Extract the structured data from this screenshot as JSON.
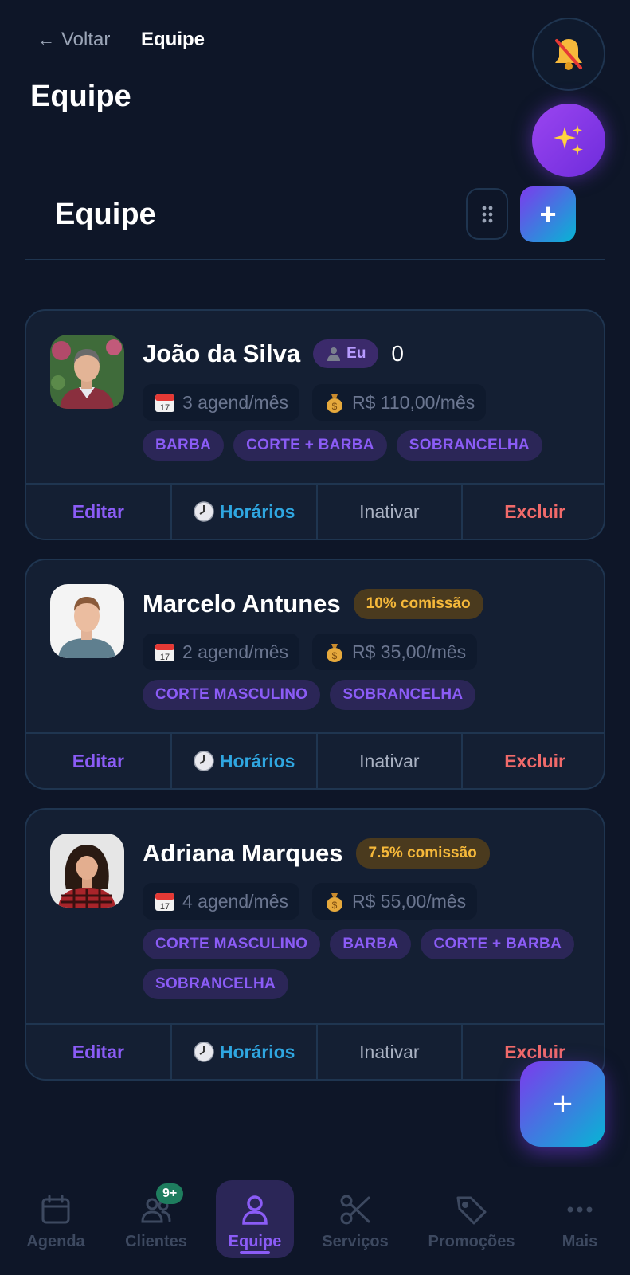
{
  "header": {
    "back_label": "Voltar",
    "breadcrumb_current": "Equipe",
    "title": "Equipe"
  },
  "section": {
    "title": "Equipe",
    "add_symbol": "+"
  },
  "members": [
    {
      "name": "João da Silva",
      "self_badge": "Eu",
      "extra_value": "0",
      "appointments": "3 agend/mês",
      "revenue": "R$ 110,00/mês",
      "services": [
        "BARBA",
        "CORTE + BARBA",
        "SOBRANCELHA"
      ]
    },
    {
      "name": "Marcelo Antunes",
      "commission": "10% comissão",
      "appointments": "2 agend/mês",
      "revenue": "R$ 35,00/mês",
      "services": [
        "CORTE MASCULINO",
        "SOBRANCELHA"
      ]
    },
    {
      "name": "Adriana Marques",
      "commission": "7.5% comissão",
      "appointments": "4 agend/mês",
      "revenue": "R$ 55,00/mês",
      "services": [
        "CORTE MASCULINO",
        "BARBA",
        "CORTE + BARBA",
        "SOBRANCELHA"
      ]
    }
  ],
  "actions": {
    "edit": "Editar",
    "hours": "Horários",
    "deactivate": "Inativar",
    "delete": "Excluir"
  },
  "fab": {
    "symbol": "+"
  },
  "nav": {
    "items": [
      {
        "label": "Agenda",
        "icon": "calendar-icon"
      },
      {
        "label": "Clientes",
        "icon": "users-icon",
        "badge": "9+"
      },
      {
        "label": "Equipe",
        "icon": "user-icon",
        "active": true
      },
      {
        "label": "Serviços",
        "icon": "scissors-icon"
      },
      {
        "label": "Promoções",
        "icon": "tag-icon"
      },
      {
        "label": "Mais",
        "icon": "more-icon"
      }
    ]
  },
  "colors": {
    "background": "#0e1628",
    "card": "#141f33",
    "accent_purple": "#8b5cf6",
    "accent_blue": "#2fa6e0",
    "danger": "#f06a6a",
    "commission": "#f5b83a"
  }
}
